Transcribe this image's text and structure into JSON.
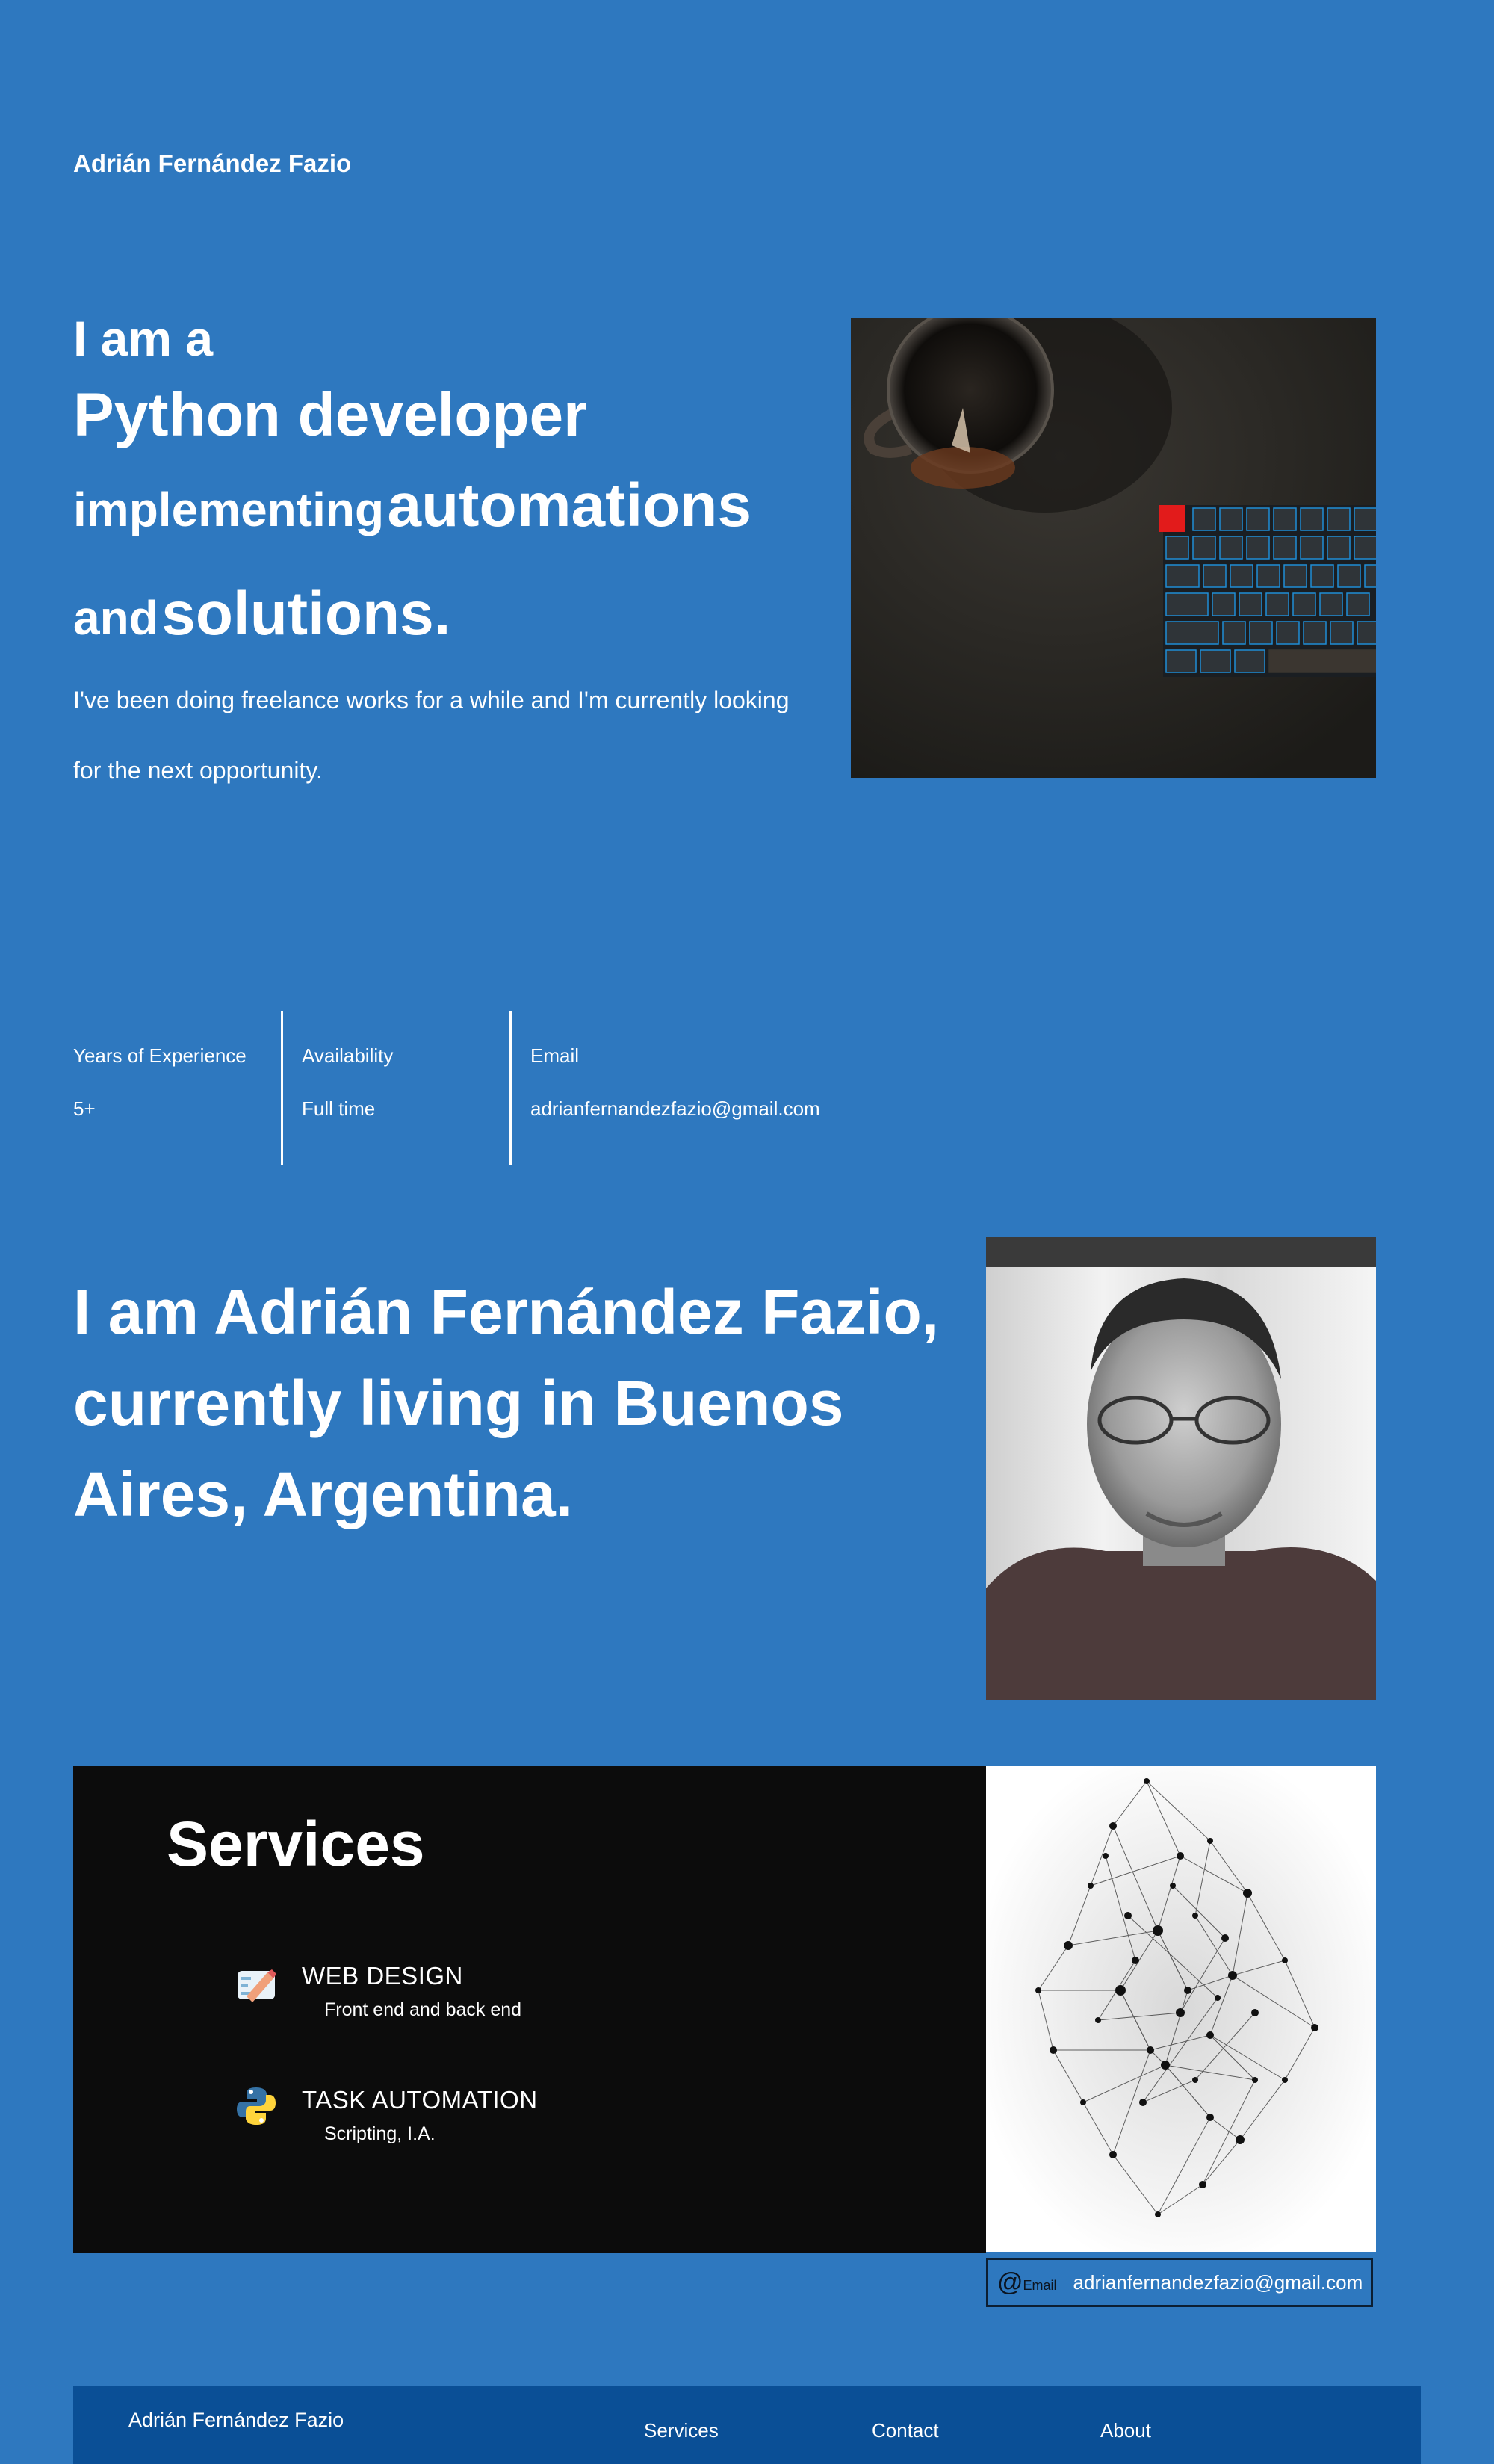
{
  "header": {
    "brand": "Adrián Fernández Fazio"
  },
  "hero": {
    "line1": "I am a",
    "line2": "Python developer",
    "line3_small": "implementing",
    "line3_big": "automations",
    "line4_small": "and",
    "line4_big": "solutions.",
    "description": "I've been doing freelance works for a while and I'm currently looking for the next opportunity."
  },
  "stats": [
    {
      "label": "Years of Experience",
      "value": "5+"
    },
    {
      "label": "Availability",
      "value": "Full time"
    },
    {
      "label": "Email",
      "value": "adrianfernandezfazio@gmail.com"
    }
  ],
  "about": {
    "heading": "I am Adrián Fernández Fazio, currently living in Buenos Aires, Argentina."
  },
  "services": {
    "title": "Services",
    "items": [
      {
        "icon": "pencil-icon",
        "title": "WEB DESIGN",
        "subtitle": "Front end and back end"
      },
      {
        "icon": "python-icon",
        "title": "TASK AUTOMATION",
        "subtitle": "Scripting, I.A."
      }
    ]
  },
  "contact": {
    "at_symbol": "@",
    "at_label": "Email",
    "email": "adrianfernandezfazio@gmail.com"
  },
  "footer": {
    "name": "Adrián Fernández Fazio",
    "nav": [
      "Services",
      "Contact",
      "About"
    ]
  },
  "colors": {
    "background": "#2e78bf",
    "services_bg": "#0c0c0c",
    "footer_bg": "#0a4f96"
  }
}
